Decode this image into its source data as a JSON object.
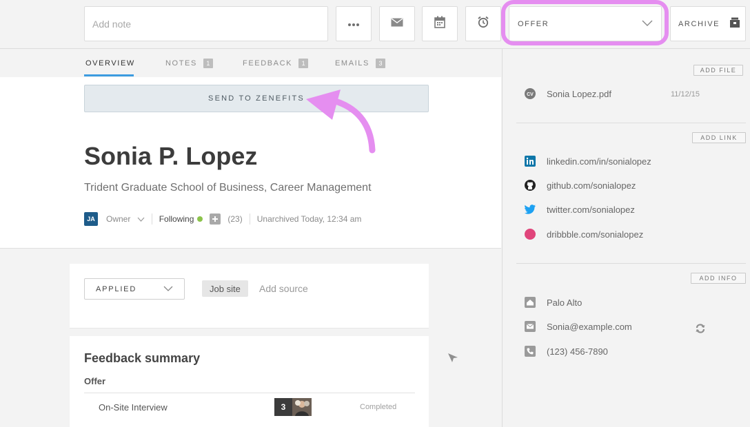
{
  "toolbar": {
    "note_placeholder": "Add note",
    "stage": "OFFER",
    "archive_label": "ARCHIVE"
  },
  "tabs": [
    {
      "label": "OVERVIEW",
      "count": ""
    },
    {
      "label": "NOTES",
      "count": "1"
    },
    {
      "label": "FEEDBACK",
      "count": "1"
    },
    {
      "label": "EMAILS",
      "count": "3"
    }
  ],
  "profile": {
    "send_label": "SEND TO ZENEFITS",
    "name": "Sonia P. Lopez",
    "school": "Trident Graduate School of Business, Career Management",
    "owner_initials": "JA",
    "owner_label": "Owner",
    "following_label": "Following",
    "follower_count": "(23)",
    "unarchived": "Unarchived Today, 12:34 am"
  },
  "source": {
    "stage": "APPLIED",
    "chip": "Job site",
    "add_source": "Add source"
  },
  "feedback": {
    "title": "Feedback summary",
    "group": "Offer",
    "row_label": "On-Site Interview",
    "count": "3",
    "status": "Completed"
  },
  "files": {
    "add_label": "ADD FILE",
    "file_icon": "CV",
    "file_name": "Sonia Lopez.pdf",
    "file_date": "11/12/15"
  },
  "links": {
    "add_label": "ADD LINK",
    "linkedin": "linkedin.com/in/sonialopez",
    "github": "github.com/sonialopez",
    "twitter": "twitter.com/sonialopez",
    "dribbble": "dribbble.com/sonialopez"
  },
  "info": {
    "add_label": "ADD INFO",
    "location": "Palo Alto",
    "email": "Sonia@example.com",
    "phone": "(123) 456-7890"
  },
  "colors": {
    "accent": "#3c9be0",
    "highlight": "#e58ef0",
    "linkedin": "#0e76a8",
    "twitter": "#1da1f2",
    "dribbble": "#e0457b"
  }
}
